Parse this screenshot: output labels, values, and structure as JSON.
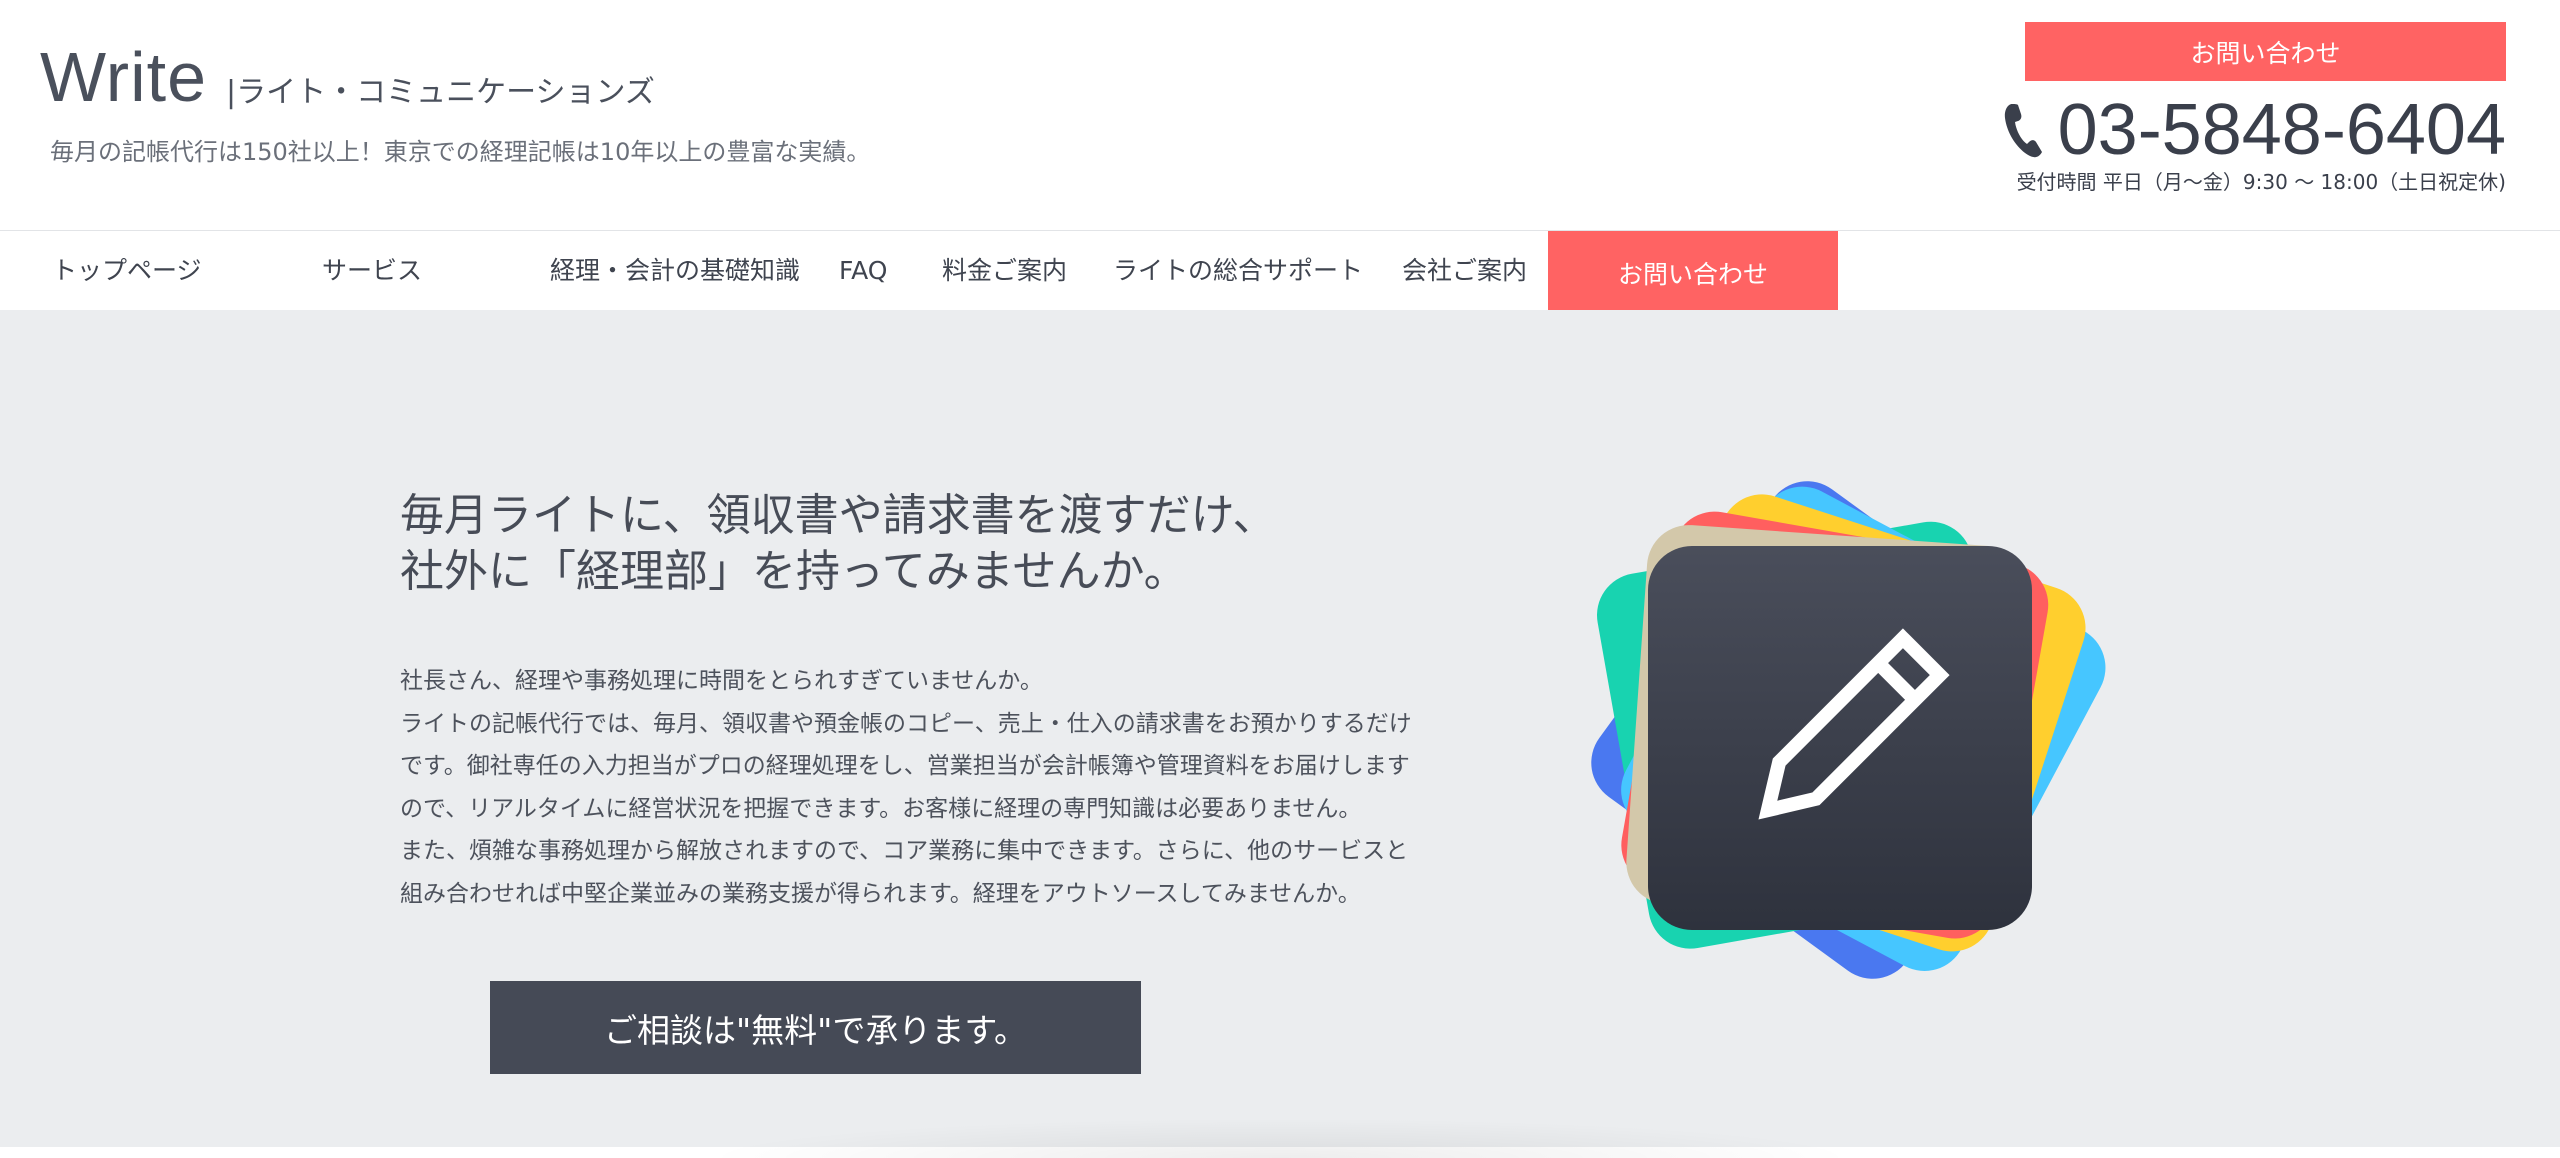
{
  "header": {
    "logo_word": "Write",
    "logo_sub": "|ライト・コミュニケーションズ",
    "tagline": "毎月の記帳代行は150社以上！東京での経理記帳は10年以上の豊富な実績。",
    "contact_button": "お問い合わせ",
    "phone_icon": "phone-icon",
    "phone_number": "03-5848-6404",
    "hours": "受付時間 平日（月〜金）9:30 〜 18:00（土日祝定休)"
  },
  "nav": {
    "items": [
      {
        "label": "トップページ"
      },
      {
        "label": "サービス"
      },
      {
        "label": "経理・会計の基礎知識"
      },
      {
        "label": "FAQ"
      },
      {
        "label": "料金ご案内"
      },
      {
        "label": "ライトの総合サポート"
      },
      {
        "label": "会社ご案内"
      }
    ],
    "cta_label": "お問い合わせ"
  },
  "hero": {
    "headline_line1": "毎月ライトに、領収書や請求書を渡すだけ、",
    "headline_line2": "社外に「経理部」を持ってみませんか。",
    "paragraph_lines": [
      "社長さん、経理や事務処理に時間をとられすぎていませんか。",
      "ライトの記帳代行では、毎月、領収書や預金帳のコピー、売上・仕入の請求書をお預かりするだけ",
      "です。御社専任の入力担当がプロの経理処理をし、営業担当が会計帳簿や管理資料をお届けします",
      "ので、リアルタイムに経営状況を把握できます。お客様に経理の専門知識は必要ありません。",
      "また、煩雑な事務処理から解放されますので、コア業務に集中できます。さらに、他のサービスと",
      "組み合わせれば中堅企業並みの業務支援が得られます。経理をアウトソースしてみませんか。"
    ],
    "cta_button": "ご相談は\"無料\"で承ります。",
    "illustration_icon": "pencil-icon"
  },
  "colors": {
    "accent": "#ff6363",
    "dark_button": "#454a56",
    "hero_bg": "#ebedef",
    "card_colors": [
      "#4a78f0",
      "#18d3b0",
      "#ff5f5f",
      "#ffcf2e",
      "#46c6ff",
      "#d3c8aa"
    ]
  }
}
